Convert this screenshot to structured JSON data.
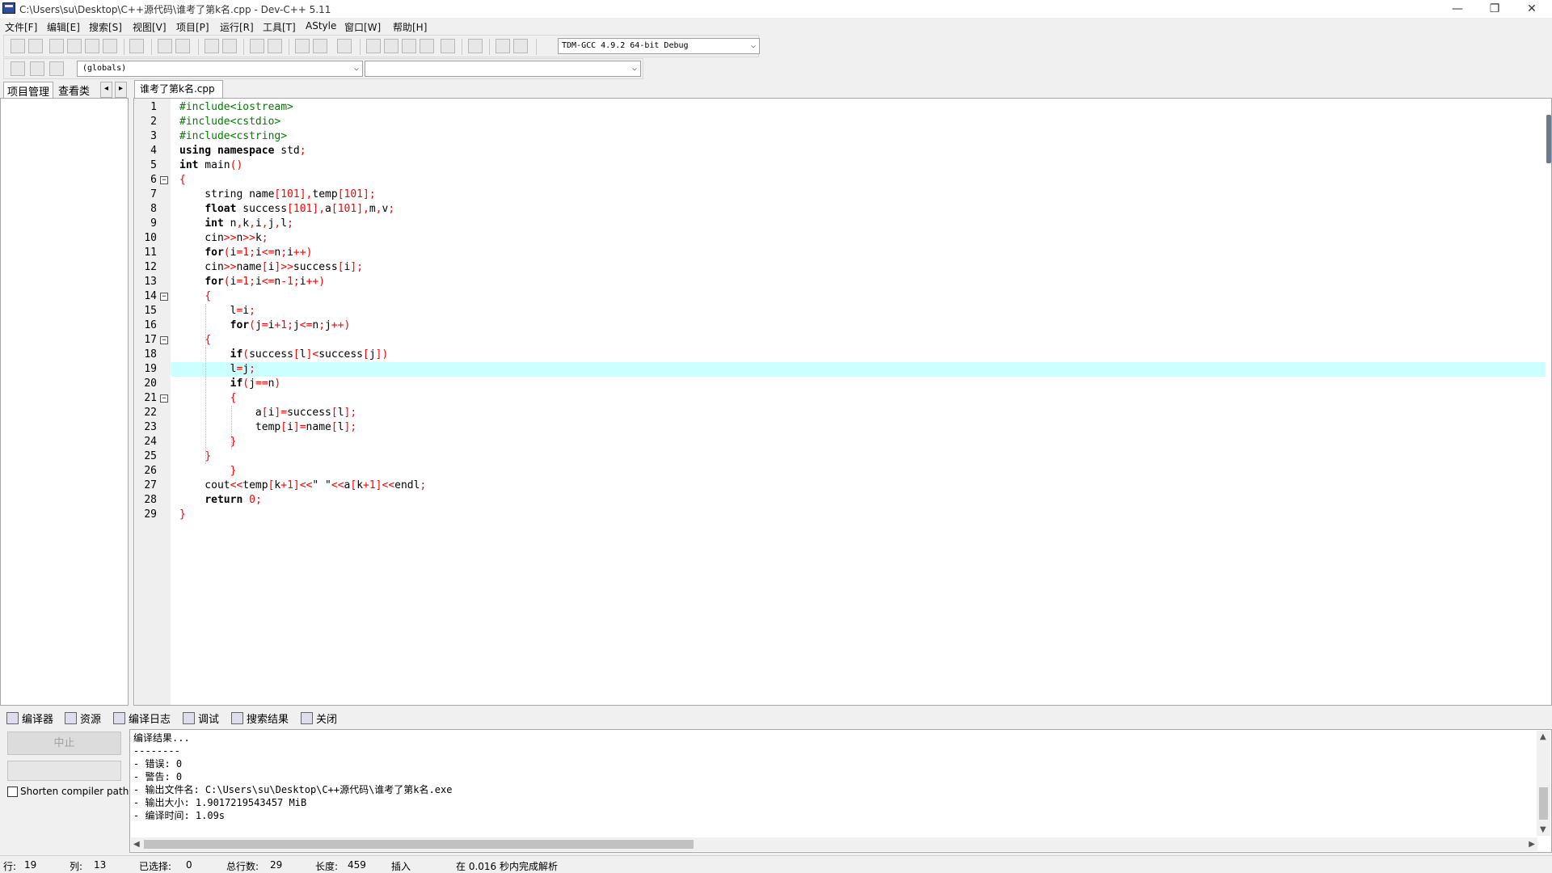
{
  "window": {
    "title": "C:\\Users\\su\\Desktop\\C++源代码\\谁考了第k名.cpp - Dev-C++ 5.11",
    "minimize": "—",
    "restore": "❐",
    "close": "✕"
  },
  "menu": [
    "文件[F]",
    "编辑[E]",
    "搜索[S]",
    "视图[V]",
    "项目[P]",
    "运行[R]",
    "工具[T]",
    "AStyle",
    "窗口[W]",
    "帮助[H]"
  ],
  "toolbar": {
    "compiler": "TDM-GCC 4.9.2 64-bit Debug",
    "scope": "(globals)",
    "member": ""
  },
  "left_tabs": {
    "project": "项目管理",
    "classes": "查看类",
    "prev": "◂",
    "next": "▸"
  },
  "editor": {
    "tab": "谁考了第k名.cpp",
    "highlighted_line": 19
  },
  "code_lines": [
    "#include<iostream>",
    "#include<cstdio>",
    "#include<cstring>",
    "using namespace std;",
    "int main()",
    "{",
    "    string name[101],temp[101];",
    "    float success[101],a[101],m,v;",
    "    int n,k,i,j,l;",
    "    cin>>n>>k;",
    "    for(i=1;i<=n;i++)",
    "    cin>>name[i]>>success[i];",
    "    for(i=1;i<=n-1;i++)",
    "    {",
    "        l=i;",
    "        for(j=i+1;j<=n;j++)",
    "    {",
    "        if(success[l]<success[j])",
    "        l=j;",
    "        if(j==n)",
    "        {",
    "            a[i]=success[l];",
    "            temp[i]=name[l];",
    "        }",
    "    }",
    "        }",
    "    cout<<temp[k+1]<<\" \"<<a[k+1]<<endl;",
    "    return 0;",
    "}"
  ],
  "bottom_tabs": {
    "compiler": "编译器",
    "resources": "资源",
    "compile_log": "编译日志",
    "debug": "调试",
    "search_results": "搜索结果",
    "close": "关闭"
  },
  "bottom_panel": {
    "stop": "中止",
    "shorten_paths": "Shorten compiler paths"
  },
  "compile_log": [
    "编译结果...",
    "--------",
    "- 错误: 0",
    "- 警告: 0",
    "- 输出文件名: C:\\Users\\su\\Desktop\\C++源代码\\谁考了第k名.exe",
    "- 输出大小: 1.9017219543457 MiB",
    "- 编译时间: 1.09s"
  ],
  "status": {
    "row_label": "行:",
    "row": "19",
    "col_label": "列:",
    "col": "13",
    "sel_label": "已选择:",
    "sel": "0",
    "total_label": "总行数:",
    "total": "29",
    "len_label": "长度:",
    "len": "459",
    "mode": "插入",
    "parse": "在 0.016 秒内完成解析"
  },
  "colors": {
    "keyword": "#000000",
    "preprocessor": "#008000",
    "symbol": "#ff0000",
    "current_line": "#ccffff"
  }
}
